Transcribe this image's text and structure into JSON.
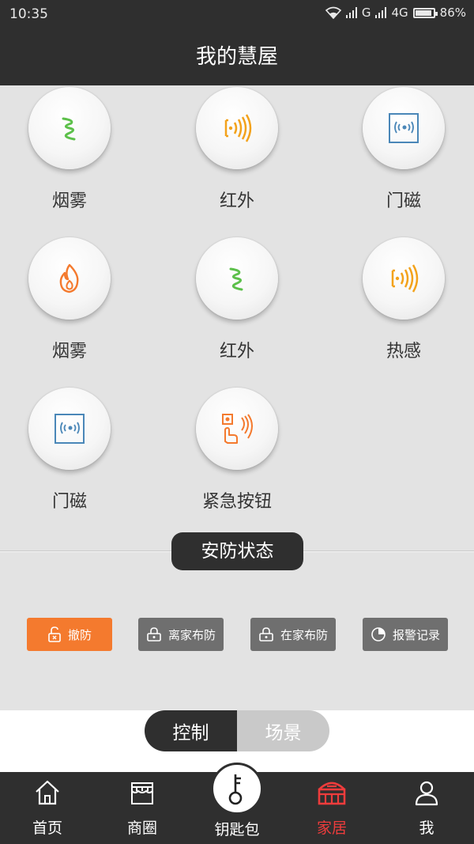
{
  "status_bar": {
    "time": "10:35",
    "network_1": "G",
    "network_2": "4G",
    "battery": "86%"
  },
  "header": {
    "title": "我的慧屋"
  },
  "devices": [
    {
      "label": "烟雾",
      "icon": "smoke-wave-icon"
    },
    {
      "label": "红外",
      "icon": "infrared-icon"
    },
    {
      "label": "门磁",
      "icon": "door-sensor-icon"
    },
    {
      "label": "烟雾",
      "icon": "flame-icon"
    },
    {
      "label": "红外",
      "icon": "smoke-wave-icon"
    },
    {
      "label": "热感",
      "icon": "infrared-icon"
    },
    {
      "label": "门磁",
      "icon": "door-sensor-icon"
    },
    {
      "label": "紧急按钮",
      "icon": "emergency-button-icon"
    }
  ],
  "security": {
    "title": "安防状态",
    "buttons": [
      {
        "label": "撤防",
        "icon": "unlock-icon",
        "active": true
      },
      {
        "label": "离家布防",
        "icon": "lock-icon",
        "active": false
      },
      {
        "label": "在家布防",
        "icon": "lock-icon",
        "active": false
      },
      {
        "label": "报警记录",
        "icon": "pie-chart-icon",
        "active": false
      }
    ]
  },
  "mode_toggle": {
    "control": "控制",
    "scene": "场景"
  },
  "tabbar": {
    "items": [
      {
        "label": "首页",
        "icon": "home-icon"
      },
      {
        "label": "商圈",
        "icon": "store-icon"
      },
      {
        "label": "钥匙包",
        "icon": "key-icon"
      },
      {
        "label": "家居",
        "icon": "house-icon",
        "active": true
      },
      {
        "label": "我",
        "icon": "user-icon"
      }
    ]
  },
  "colors": {
    "dark": "#2f2f2f",
    "accent": "#f47a2e",
    "active_tab": "#ee3c3c",
    "green": "#5cc04a",
    "orange": "#f3a21b",
    "blue": "#4a87b8"
  }
}
